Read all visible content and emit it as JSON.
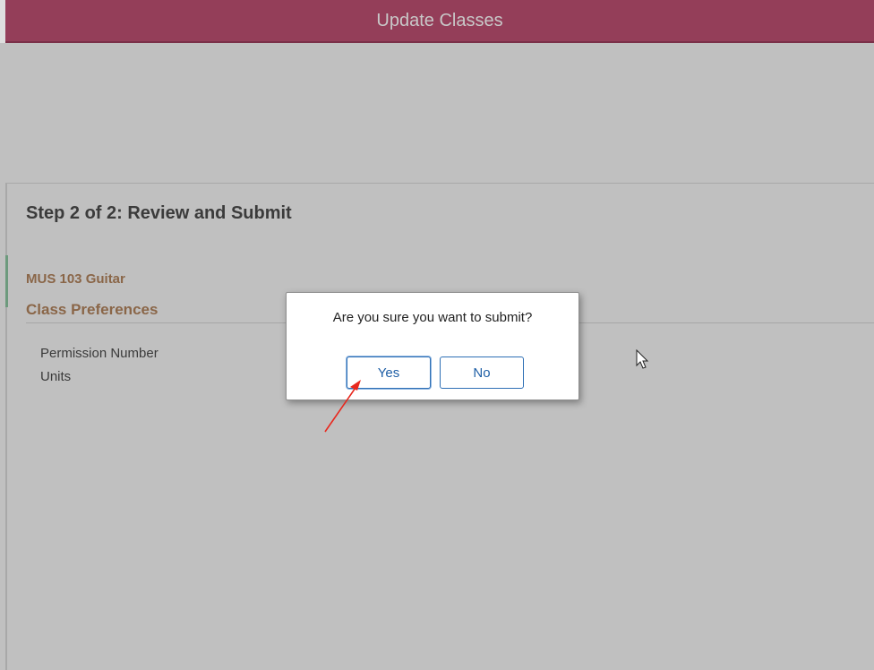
{
  "header": {
    "title": "Update Classes"
  },
  "step": {
    "title": "Step 2 of 2: Review and Submit"
  },
  "class_info": {
    "name": "MUS 103 Guitar",
    "section_title": "Class Preferences",
    "fields": [
      {
        "label": "Permission Number"
      },
      {
        "label": "Units"
      }
    ]
  },
  "dialog": {
    "message": "Are you sure you want to submit?",
    "yes_label": "Yes",
    "no_label": "No"
  },
  "colors": {
    "header_bg": "#943e59",
    "accent_text": "#8a6648",
    "button_border": "#2e6fb5",
    "annotation_arrow": "#e8281e"
  },
  "icons": {
    "cursor": "mouse-pointer-icon",
    "annotation": "red-arrow-annotation"
  }
}
